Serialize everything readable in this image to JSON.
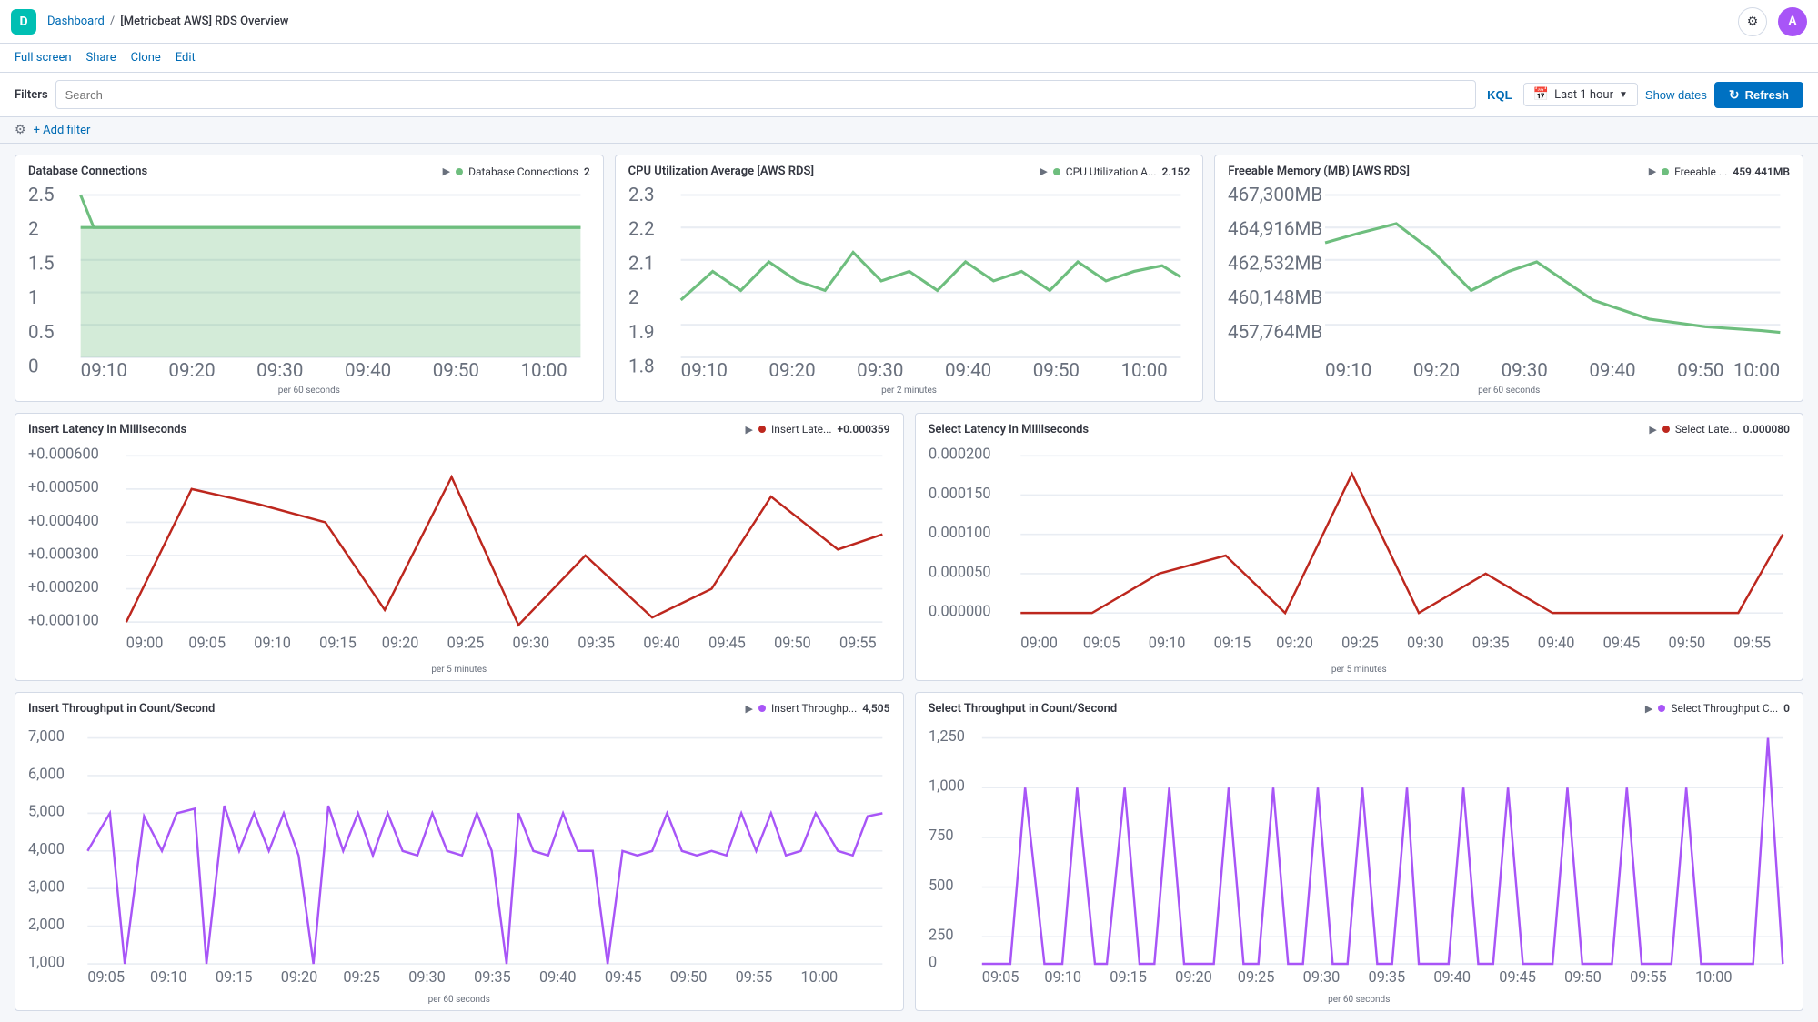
{
  "app": {
    "icon_label": "D",
    "breadcrumb_parent": "Dashboard",
    "breadcrumb_separator": "/",
    "page_title": "[Metricbeat AWS] RDS Overview"
  },
  "top_bar": {
    "settings_icon": "⚙",
    "avatar_label": "A"
  },
  "action_bar": {
    "full_screen": "Full screen",
    "share": "Share",
    "clone": "Clone",
    "edit": "Edit"
  },
  "filter_bar": {
    "label": "Filters",
    "search_placeholder": "Search",
    "kql_label": "KQL",
    "date_icon": "📅",
    "date_range": "Last 1 hour",
    "show_dates": "Show dates",
    "refresh_label": "Refresh",
    "refresh_icon": "↻"
  },
  "add_filter": {
    "gear_icon": "⚙",
    "label": "+ Add filter"
  },
  "panels": {
    "row1": [
      {
        "id": "db-connections",
        "title": "Database Connections",
        "legend_label": "Database Connections",
        "legend_value": "2",
        "per_label": "per 60 seconds",
        "color": "#6ebe7e",
        "type": "area",
        "y_labels": [
          "2.5",
          "2",
          "1.5",
          "1",
          "0.5",
          "0"
        ],
        "x_labels": [
          "09:10",
          "09:20",
          "09:30",
          "09:40",
          "09:50",
          "10:00"
        ]
      },
      {
        "id": "cpu-util",
        "title": "CPU Utilization Average [AWS RDS]",
        "legend_label": "CPU Utilization A...",
        "legend_value": "2.152",
        "per_label": "per 2 minutes",
        "color": "#6ebe7e",
        "type": "line",
        "y_labels": [
          "2.3",
          "2.2",
          "2.1",
          "2",
          "1.9",
          "1.8"
        ],
        "x_labels": [
          "09:10",
          "09:20",
          "09:30",
          "09:40",
          "09:50",
          "10:00"
        ]
      },
      {
        "id": "freeable-mem",
        "title": "Freeable Memory (MB) [AWS RDS]",
        "legend_label": "Freeable ...",
        "legend_value": "459.441MB",
        "per_label": "per 60 seconds",
        "color": "#6ebe7e",
        "type": "line",
        "y_labels": [
          "467,300MB",
          "464,916MB",
          "462,532MB",
          "460,148MB",
          "457,764MB"
        ],
        "x_labels": [
          "09:10",
          "09:20",
          "09:30",
          "09:40",
          "09:50",
          "10:00"
        ]
      }
    ],
    "row2": [
      {
        "id": "insert-latency",
        "title": "Insert Latency in Milliseconds",
        "legend_label": "Insert Late...",
        "legend_value": "+0.000359",
        "per_label": "per 5 minutes",
        "color": "#bd271e",
        "type": "line",
        "y_labels": [
          "+0.000600",
          "+0.000500",
          "+0.000400",
          "+0.000300",
          "+0.000200",
          "+0.000100"
        ],
        "x_labels": [
          "09:00",
          "09:05",
          "09:10",
          "09:15",
          "09:20",
          "09:25",
          "09:30",
          "09:35",
          "09:40",
          "09:45",
          "09:50",
          "09:55"
        ]
      },
      {
        "id": "select-latency",
        "title": "Select Latency in Milliseconds",
        "legend_label": "Select Late...",
        "legend_value": "0.000080",
        "per_label": "per 5 minutes",
        "color": "#bd271e",
        "type": "line",
        "y_labels": [
          "0.000200",
          "0.000150",
          "0.000100",
          "0.000050",
          "0.000000"
        ],
        "x_labels": [
          "09:00",
          "09:05",
          "09:10",
          "09:15",
          "09:20",
          "09:25",
          "09:30",
          "09:35",
          "09:40",
          "09:45",
          "09:50",
          "09:55"
        ]
      }
    ],
    "row3": [
      {
        "id": "insert-throughput",
        "title": "Insert Throughput in Count/Second",
        "legend_label": "Insert Throughp...",
        "legend_value": "4,505",
        "per_label": "per 60 seconds",
        "color": "#a855f7",
        "type": "line",
        "y_labels": [
          "7,000",
          "6,000",
          "5,000",
          "4,000",
          "3,000",
          "2,000",
          "1,000"
        ],
        "x_labels": [
          "09:05",
          "09:10",
          "09:15",
          "09:20",
          "09:25",
          "09:30",
          "09:35",
          "09:40",
          "09:45",
          "09:50",
          "09:55",
          "10:00"
        ]
      },
      {
        "id": "select-throughput",
        "title": "Select Throughput in Count/Second",
        "legend_label": "Select Throughput C...",
        "legend_value": "0",
        "per_label": "per 60 seconds",
        "color": "#a855f7",
        "type": "line",
        "y_labels": [
          "1,250",
          "1,000",
          "750",
          "500",
          "250",
          "0"
        ],
        "x_labels": [
          "09:05",
          "09:10",
          "09:15",
          "09:20",
          "09:25",
          "09:30",
          "09:35",
          "09:40",
          "09:45",
          "09:50",
          "09:55",
          "10:00"
        ]
      }
    ]
  }
}
